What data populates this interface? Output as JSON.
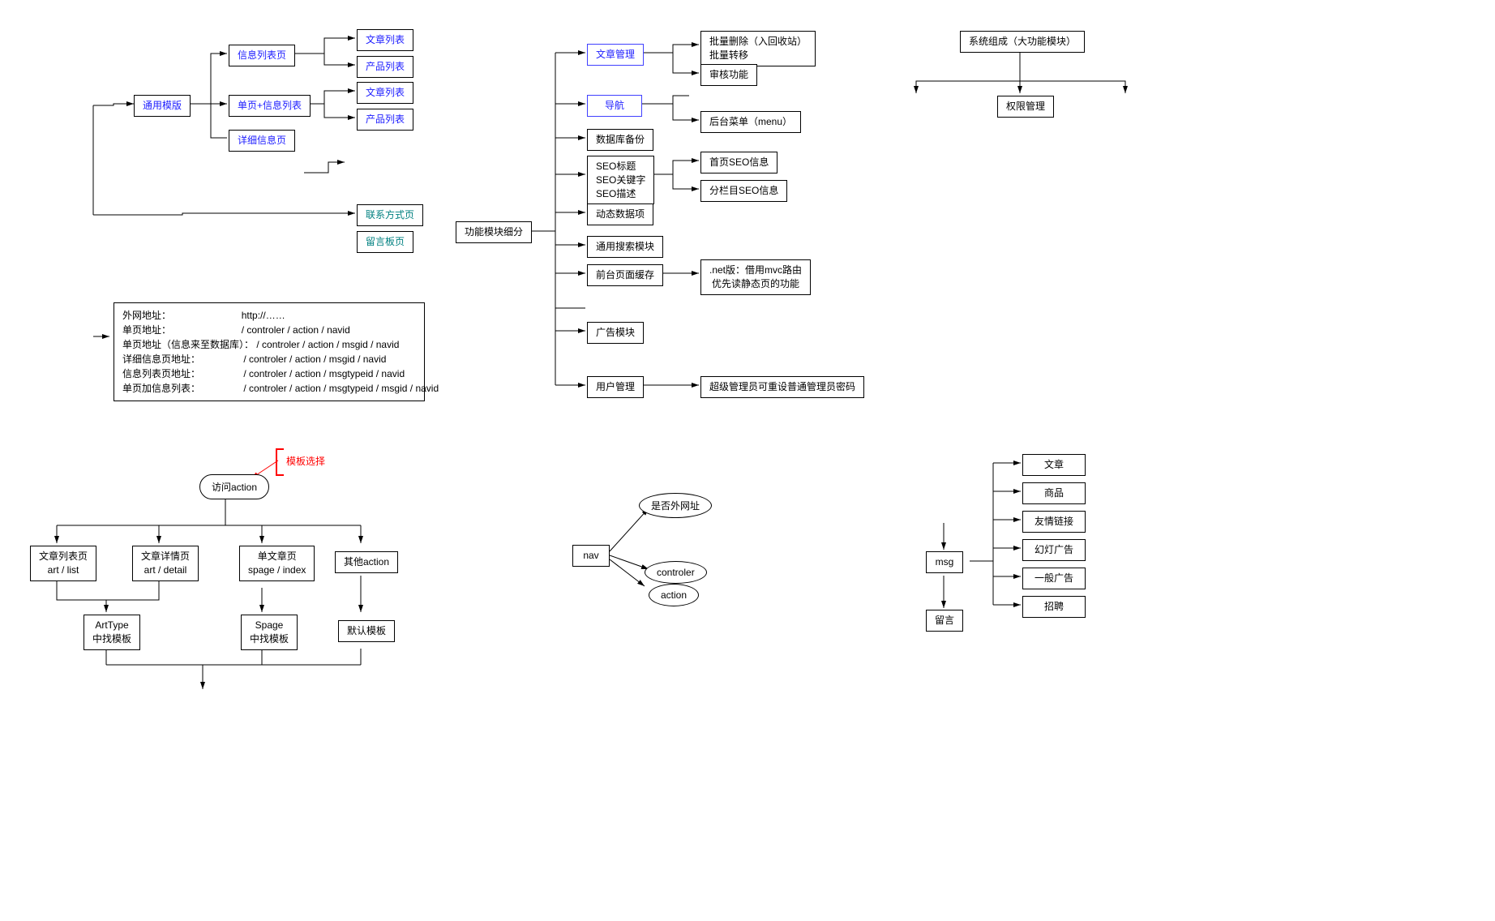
{
  "top_left": {
    "generic_template": "通用模版",
    "info_list_page": "信息列表页",
    "single_info_list": "单页+信息列表",
    "detail_page": "详细信息页",
    "article_list1": "文章列表",
    "product_list1": "产品列表",
    "article_list2": "文章列表",
    "product_list2": "产品列表",
    "contact_page": "联系方式页",
    "guestbook_page": "留言板页"
  },
  "url_block": {
    "l1": "外网地址：",
    "v1": "http://……",
    "l2": "单页地址：",
    "v2": "/ controler / action / navid",
    "l3": "单页地址（信息来至数据库）：",
    "v3": "/ controler / action / msgid / navid",
    "l4": "详细信息页地址：",
    "v4": "/ controler / action / msgid / navid",
    "l5": "信息列表页地址：",
    "v5": "/ controler / action / msgtypeid / navid",
    "l6": "单页加信息列表：",
    "v6": "/ controler / action / msgtypeid / msgid / navid"
  },
  "middle": {
    "module_detail": "功能模块细分",
    "article_mgmt": "文章管理",
    "batch_delete": "批量删除（入回收站）\n批量转移",
    "review": "审核功能",
    "navigation": "导航",
    "backend_menu": "后台菜单（menu）",
    "db_backup": "数据库备份",
    "seo_block": "SEO标题\nSEO关键字\nSEO描述",
    "home_seo": "首页SEO信息",
    "column_seo": "分栏目SEO信息",
    "dynamic_data": "动态数据项",
    "search_module": "通用搜索模块",
    "page_cache": "前台页面缓存",
    "cache_note": ".net版：借用mvc路由\n优先读静态页的功能",
    "ad_module": "广告模块",
    "user_mgmt": "用户管理",
    "admin_note": "超级管理员可重设普通管理员密码"
  },
  "top_right": {
    "system_comp": "系统组成（大功能模块）",
    "perm_mgmt": "权限管理"
  },
  "bottom_left": {
    "template_select": "模板选择",
    "visit_action": "访问action",
    "article_list_page": "文章列表页\nart / list",
    "article_detail_page": "文章详情页\nart / detail",
    "single_article_page": "单文章页\nspage / index",
    "other_action": "其他action",
    "arttype_find": "ArtType\n中找模板",
    "spage_find": "Spage\n中找模板",
    "default_template": "默认模板"
  },
  "bottom_mid": {
    "nav": "nav",
    "is_external": "是否外网址",
    "controler": "controler",
    "action": "action"
  },
  "bottom_right": {
    "msg": "msg",
    "guestbook": "留言",
    "article": "文章",
    "product": "商品",
    "friendlink": "友情链接",
    "slide_ad": "幻灯广告",
    "general_ad": "一般广告",
    "recruit": "招聘"
  }
}
